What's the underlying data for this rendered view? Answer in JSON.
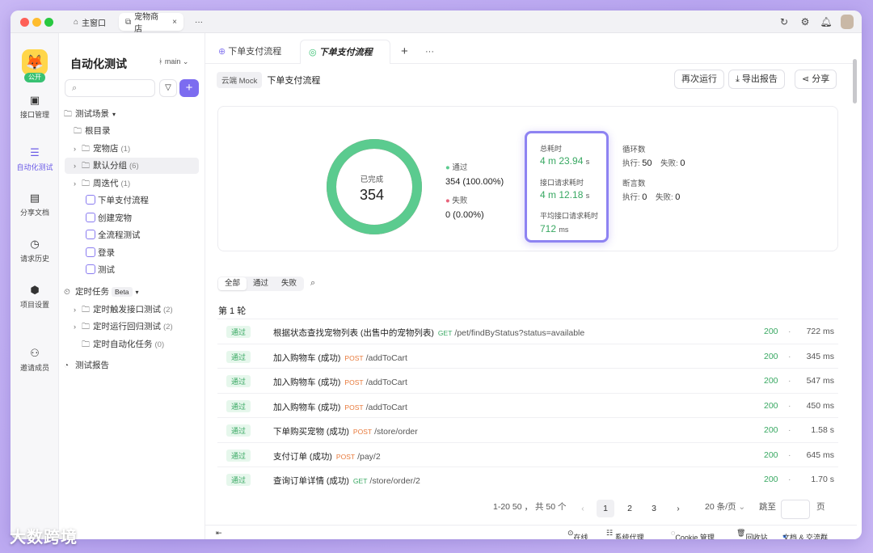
{
  "window_tabs": [
    {
      "label": "主窗口"
    },
    {
      "label": "宠物商店"
    }
  ],
  "left_nav": {
    "public_badge": "公开",
    "items": [
      {
        "label": "接口管理"
      },
      {
        "label": "自动化测试"
      },
      {
        "label": "分享文档"
      },
      {
        "label": "请求历史"
      },
      {
        "label": "项目设置"
      },
      {
        "label": "邀请成员"
      }
    ]
  },
  "tree": {
    "title": "自动化测试",
    "branch": "main",
    "section1": "测试场景",
    "root": "根目录",
    "folders": [
      {
        "label": "宠物店",
        "count": "(1)"
      },
      {
        "label": "默认分组",
        "count": "(6)"
      },
      {
        "label": "周迭代",
        "count": "(1)"
      }
    ],
    "docs": [
      {
        "label": "下单支付流程"
      },
      {
        "label": "创建宠物"
      },
      {
        "label": "全流程测试"
      },
      {
        "label": "登录"
      },
      {
        "label": "测试"
      }
    ],
    "section2": "定时任务",
    "beta": "Beta",
    "tasks": [
      {
        "label": "定时触发接口测试",
        "count": "(2)"
      },
      {
        "label": "定时运行回归测试",
        "count": "(2)"
      },
      {
        "label": "定时自动化任务",
        "count": "(0)"
      }
    ],
    "section3": "测试报告"
  },
  "tabs": [
    {
      "label": "下单支付流程"
    },
    {
      "label": "下单支付流程"
    }
  ],
  "breadcrumb": {
    "env": "云端 Mock",
    "name": "下单支付流程"
  },
  "actions": {
    "rerun": "再次运行",
    "export": "导出报告",
    "share": "分享"
  },
  "summary": {
    "done_label": "已完成",
    "done_value": "354",
    "pass_label": "通过",
    "pass_value": "354 (100.00%)",
    "fail_label": "失败",
    "fail_value": "0 (0.00%)",
    "total_time_label": "总耗时",
    "total_time_num": "4 m 23.94",
    "total_time_unit": "s",
    "req_time_label": "接口请求耗时",
    "req_time_num": "4 m 12.18",
    "req_time_unit": "s",
    "avg_time_label": "平均接口请求耗时",
    "avg_time_num": "712",
    "avg_time_unit": "ms",
    "loop_label": "循环数",
    "assert_label": "断言数",
    "exec_label": "执行:",
    "fail_short": "失败:",
    "loop_exec": "50",
    "loop_fail": "0",
    "assert_exec": "0",
    "assert_fail": "0",
    "pass_ratio": 1.0,
    "colors": {
      "pass": "#5bcb8f",
      "fail": "#e8637a",
      "highlight": "#8e83f2"
    }
  },
  "filters": [
    {
      "label": "全部"
    },
    {
      "label": "通过"
    },
    {
      "label": "失败"
    }
  ],
  "round_label": "第 1 轮",
  "rows": [
    {
      "status": "通过",
      "name": "根据状态查找宠物列表 (出售中的宠物列表)",
      "method": "GET",
      "path": "/pet/findByStatus?status=available",
      "code": "200",
      "time": "722 ms"
    },
    {
      "status": "通过",
      "name": "加入购物车 (成功)",
      "method": "POST",
      "path": "/addToCart",
      "code": "200",
      "time": "345 ms"
    },
    {
      "status": "通过",
      "name": "加入购物车 (成功)",
      "method": "POST",
      "path": "/addToCart",
      "code": "200",
      "time": "547 ms"
    },
    {
      "status": "通过",
      "name": "加入购物车 (成功)",
      "method": "POST",
      "path": "/addToCart",
      "code": "200",
      "time": "450 ms"
    },
    {
      "status": "通过",
      "name": "下单购买宠物 (成功)",
      "method": "POST",
      "path": "/store/order",
      "code": "200",
      "time": "1.58 s"
    },
    {
      "status": "通过",
      "name": "支付订单 (成功)",
      "method": "POST",
      "path": "/pay/2",
      "code": "200",
      "time": "645 ms"
    },
    {
      "status": "通过",
      "name": "查询订单详情 (成功)",
      "method": "GET",
      "path": "/store/order/2",
      "code": "200",
      "time": "1.70 s"
    }
  ],
  "pagination": {
    "range": "1-20 50 ， 共 50 个",
    "pages": [
      "1",
      "2",
      "3"
    ],
    "per_page": "20 条/页",
    "jump": "跳至",
    "page_unit": "页"
  },
  "statusbar": {
    "online": "在线",
    "proxy": "系统代理",
    "cookie": "Cookie 管理",
    "trash": "回收站",
    "docs": "文档 & 交流群"
  },
  "watermark": "大数跨境"
}
